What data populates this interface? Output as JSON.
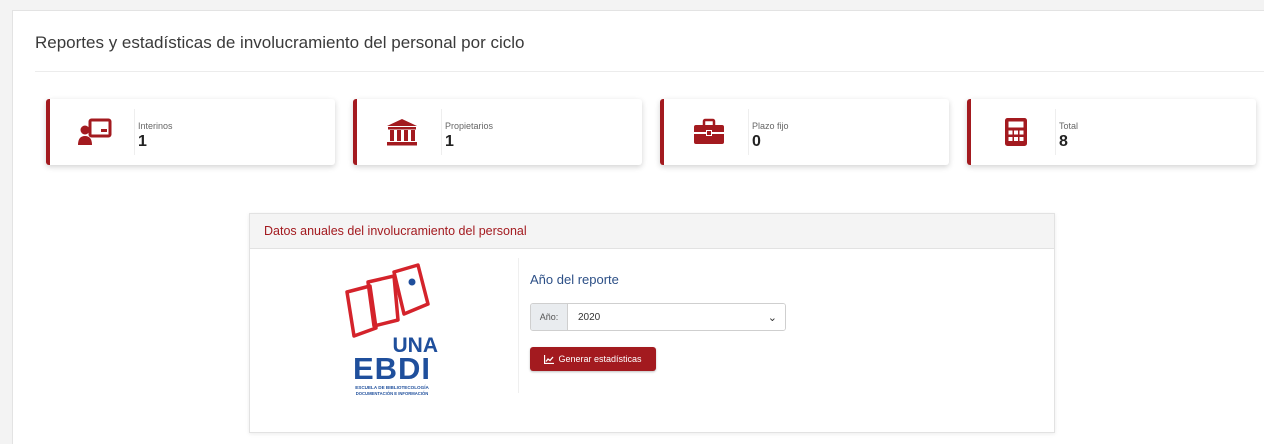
{
  "page": {
    "title": "Reportes y estadísticas de involucramiento del personal por ciclo"
  },
  "stats": [
    {
      "label": "Interinos",
      "value": "1",
      "icon": "teacher-icon"
    },
    {
      "label": "Propietarios",
      "value": "1",
      "icon": "institution-icon"
    },
    {
      "label": "Plazo fijo",
      "value": "0",
      "icon": "briefcase-icon"
    },
    {
      "label": "Total",
      "value": "8",
      "icon": "calculator-icon"
    }
  ],
  "panel": {
    "header": "Datos anuales del involucramiento del personal",
    "logo": {
      "line1": "UNA",
      "line2": "EBDI",
      "caption1": "ESCUELA DE BIBLIOTECOLOGÍA",
      "caption2": "DOCUMENTACIÓN E INFORMACIÓN"
    },
    "form_title": "Año del reporte",
    "year_addon": "Año:",
    "year_value": "2020",
    "button_label": "Generar estadísticas"
  },
  "colors": {
    "accent": "#a31a1f",
    "link_blue": "#2c4f86",
    "logo_blue": "#1f4f9c"
  }
}
